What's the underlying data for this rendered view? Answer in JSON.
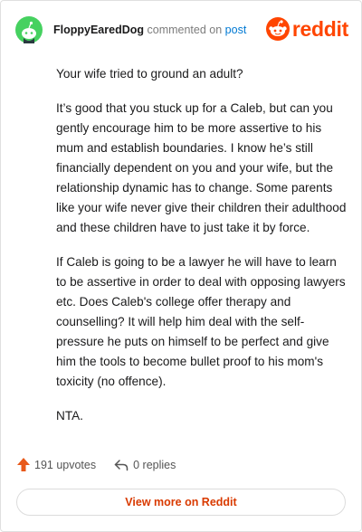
{
  "comment": {
    "author": "FloppyEaredDog",
    "action_text": "commented on",
    "post_link": "post",
    "paragraphs": [
      "Your wife tried to ground an adult?",
      "It’s good that you stuck up for a Caleb, but can you gently encourage him to be more assertive to his mum and establish boundaries. I know he’s still financially dependent on you and your wife, but the relationship dynamic has to change. Some parents like your wife never give their children their adulthood and these children have to just take it by force.",
      "If Caleb is going to be a lawyer he will have to learn to be assertive in order to deal with opposing lawyers etc. Does Caleb's college offer therapy and counselling? It will help him deal with the self-pressure he puts on himself to be perfect and give him the tools to become bullet proof to his mom's toxicity (no offence).",
      "NTA."
    ]
  },
  "brand": {
    "logo_text": "reddit",
    "color": "#ff4500"
  },
  "stats": {
    "upvotes": "191 upvotes",
    "replies": "0 replies",
    "upvote_color": "#e8591a"
  },
  "cta": {
    "label": "View more on Reddit",
    "color": "#d93a00"
  },
  "icons": {
    "avatar": "snoo-avatar-icon",
    "logo": "reddit-alien-icon",
    "upvote": "upvote-arrow-icon",
    "reply": "reply-arrow-icon"
  }
}
